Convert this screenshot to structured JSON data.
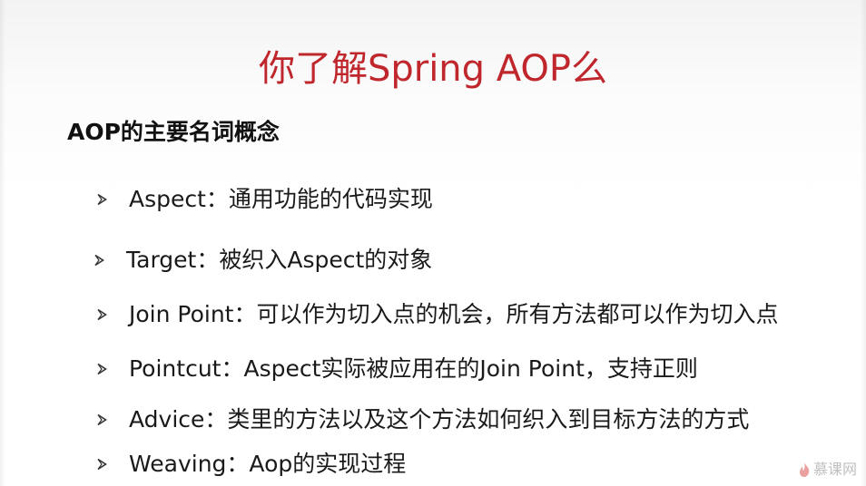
{
  "slide": {
    "title": "你了解Spring AOP么",
    "subtitle": "AOP的主要名词概念",
    "bullets": [
      {
        "text": "Aspect：通用功能的代码实现"
      },
      {
        "text": "Target：被织入Aspect的对象"
      },
      {
        "text": "Join Point：可以作为切入点的机会，所有方法都可以作为切入点"
      },
      {
        "text": "Pointcut：Aspect实际被应用在的Join Point，支持正则"
      },
      {
        "text": "Advice：类里的方法以及这个方法如何织入到目标方法的方式"
      },
      {
        "text": "Weaving：Aop的实现过程"
      }
    ]
  },
  "watermark": {
    "text": "慕课网",
    "icon": "flame-icon"
  },
  "colors": {
    "title": "#c0272d",
    "text": "#1a1a1a",
    "background": "#ffffff"
  }
}
